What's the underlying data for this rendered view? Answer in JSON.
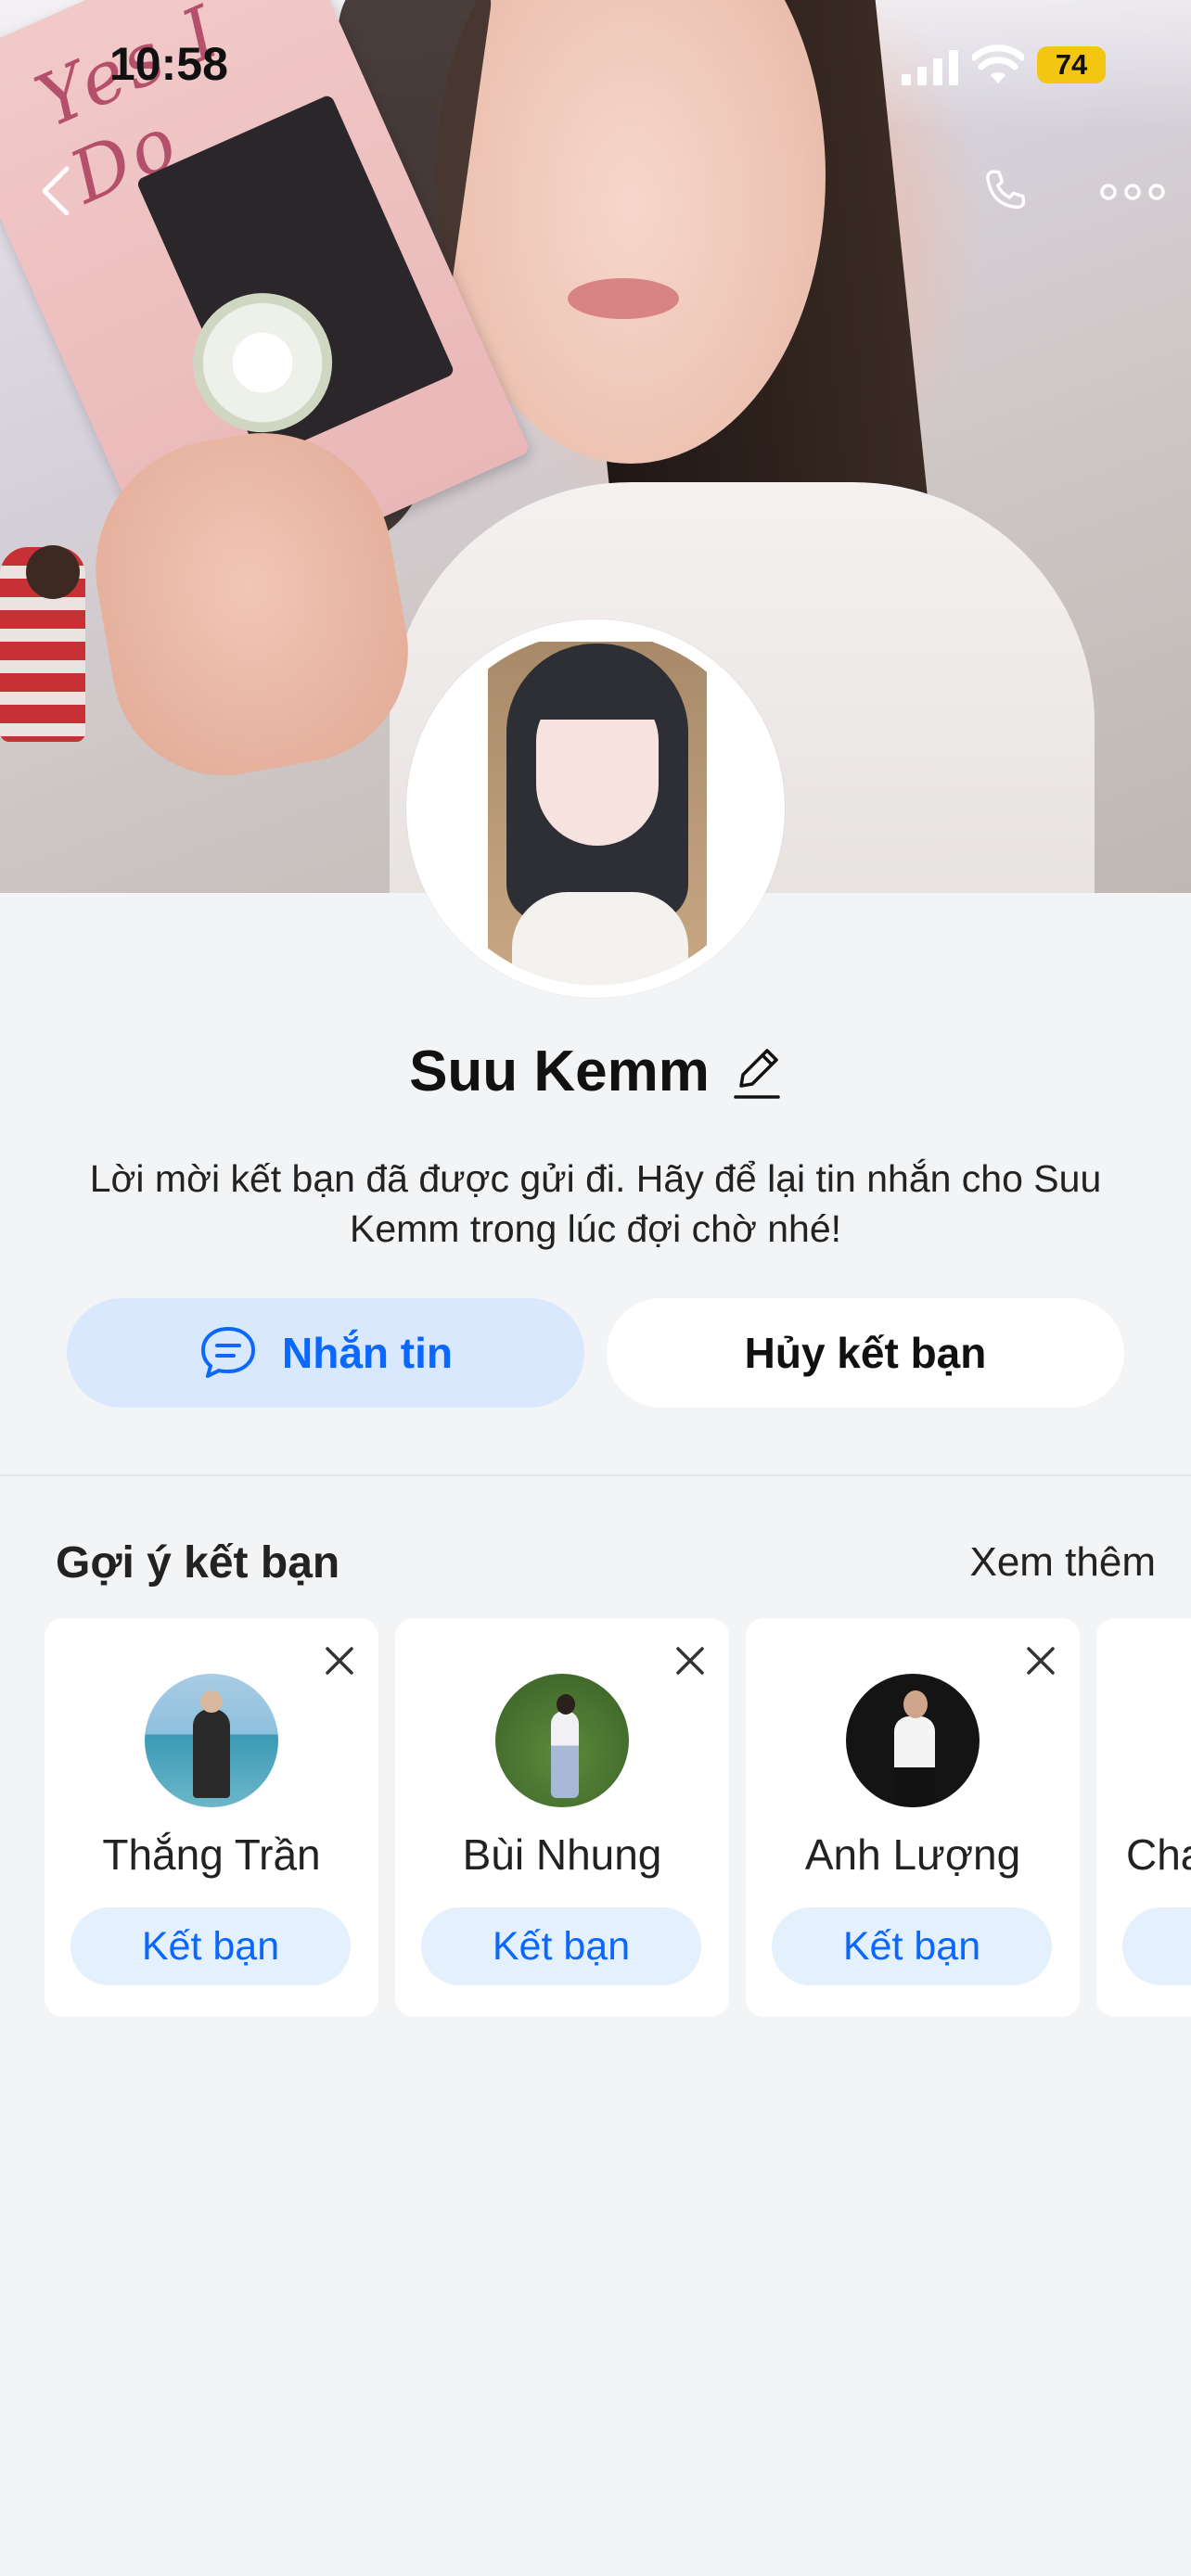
{
  "status_bar": {
    "time": "10:58",
    "battery": "74"
  },
  "profile": {
    "name": "Suu Kemm",
    "description": "Lời mời kết bạn đã được gửi đi. Hãy để lại tin nhắn cho Suu Kemm trong lúc đợi chờ nhé!",
    "message_button": "Nhắn tin",
    "cancel_button": "Hủy kết bạn"
  },
  "suggestions": {
    "title": "Gợi ý kết bạn",
    "see_more": "Xem thêm",
    "items": [
      {
        "name": "Thắng Trần",
        "button": "Kết bạn"
      },
      {
        "name": "Bùi Nhung",
        "button": "Kết bạn"
      },
      {
        "name": "Anh Lượng",
        "button": "Kết bạn"
      },
      {
        "name": "Cha",
        "button": ""
      }
    ]
  },
  "colors": {
    "accent": "#0a68ff",
    "accent_bg": "#d9e8fd",
    "page_bg": "#f3f4f6",
    "battery": "#f3c614"
  },
  "icons": [
    "back-icon",
    "phone-icon",
    "more-icon",
    "edit-pencil-icon",
    "chat-bubble-icon",
    "close-icon"
  ]
}
